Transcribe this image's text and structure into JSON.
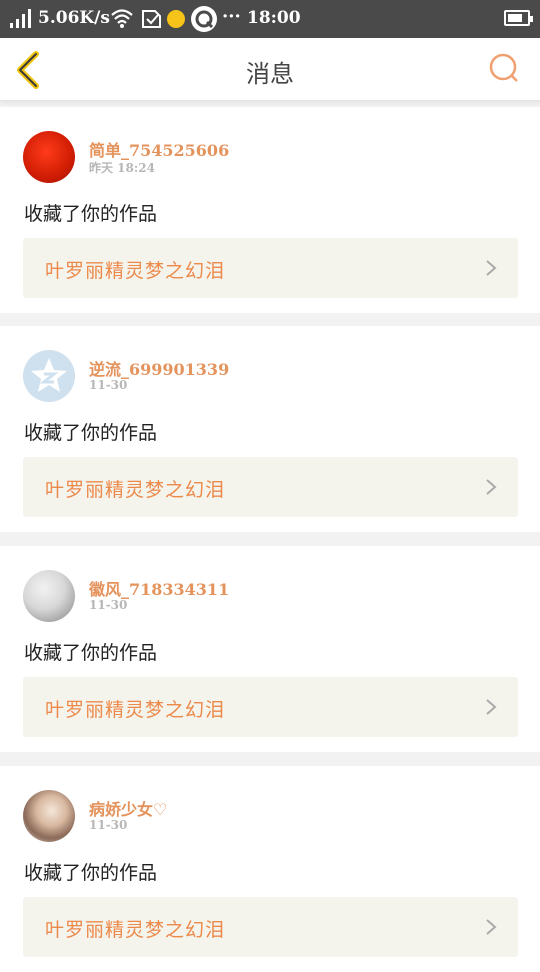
{
  "status_bar": {
    "net_speed": "5.06K/s",
    "dots": "···",
    "time": "18:00"
  },
  "header": {
    "title": "消息"
  },
  "notifications": [
    {
      "user": "简单_754525606",
      "time": "昨天 18:24",
      "action": "收藏了你的作品",
      "work": "叶罗丽精灵梦之幻泪",
      "avatar": "red-circle"
    },
    {
      "user": "逆流_699901339",
      "time": "11-30",
      "action": "收藏了你的作品",
      "work": "叶罗丽精灵梦之幻泪",
      "avatar": "qq-default"
    },
    {
      "user": "徽风_718334311",
      "time": "11-30",
      "action": "收藏了你的作品",
      "work": "叶罗丽精灵梦之幻泪",
      "avatar": "photo-gray"
    },
    {
      "user": "病娇少女♡",
      "time": "11-30",
      "action": "收藏了你的作品",
      "work": "叶罗丽精灵梦之幻泪",
      "avatar": "photo-warm"
    }
  ],
  "colors": {
    "accent": "#e4935c",
    "back_icon": "#f1c40f",
    "status_bar_bg": "#4a4a4a",
    "work_bg": "#f4f3ec"
  }
}
